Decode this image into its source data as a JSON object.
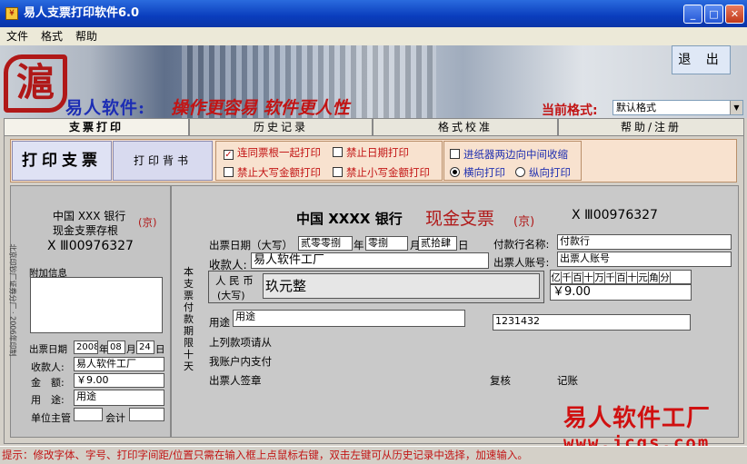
{
  "window": {
    "title": "易人支票打印软件6.0",
    "icon": "app-icon",
    "minimize": "_",
    "maximize": "□",
    "close": "✕"
  },
  "menu": [
    "文件",
    "格式",
    "帮助"
  ],
  "banner": {
    "brand": "易人软件:",
    "slogan": "操作更容易 软件更人性",
    "logo": "滬"
  },
  "exit_label": "退 出",
  "format": {
    "label": "当前格式:",
    "value": "默认格式"
  },
  "tabs": [
    "支票打印",
    "历史记录",
    "格式校准",
    "帮助/注册"
  ],
  "toolbar": {
    "print": "打印支票",
    "print_back": "打印背书"
  },
  "options": {
    "with_stub": {
      "label": "连同票根一起打印",
      "checked": true
    },
    "no_date": {
      "label": "禁止日期打印",
      "checked": false
    },
    "no_upper": {
      "label": "禁止大写金额打印",
      "checked": false
    },
    "no_lower": {
      "label": "禁止小写金额打印",
      "checked": false
    },
    "feed_center": {
      "label": "进纸器两边向中间收缩",
      "checked": false
    },
    "landscape": {
      "label": "横向打印",
      "checked": true
    },
    "portrait": {
      "label": "纵向打印",
      "checked": false
    }
  },
  "stub": {
    "bank": "中国 XXX 银行",
    "title": "现金支票存根",
    "region": "(京)",
    "serial": "X Ⅲ00976327",
    "side_text": "北京印钞厂证券分厂 · 2006年印制",
    "extra_label": "附加信息",
    "date_label": "出票日期",
    "year": "2008",
    "month": "08",
    "day": "24",
    "y": "年",
    "m": "月",
    "d": "日",
    "payee_label": "收款人:",
    "payee": "易人软件工厂",
    "amount_label": "金　额:",
    "amount": "￥9.00",
    "usage_label": "用　途:",
    "usage": "用途",
    "manager_label": "单位主管",
    "accountant_label": "会计"
  },
  "check": {
    "bank": "中国 XXXX 银行",
    "title": "现金支票",
    "region": "(京)",
    "serial": "X Ⅲ00976327",
    "side_text": "本支票付款期限十天",
    "date_label": "出票日期（大写）",
    "year": "贰零零捌",
    "year_unit": "年",
    "month": "零捌",
    "month_unit": "月",
    "day": "贰拾肆",
    "day_unit": "日",
    "bank_name_label": "付款行名称:",
    "bank_name": "付款行",
    "account_label": "出票人账号:",
    "account": "出票人账号",
    "payee_label": "收款人:",
    "payee": "易人软件工厂",
    "rmb_label": "人 民 币",
    "rmb_sub": "(大写)",
    "amount_upper": "玖元整",
    "digits": [
      "亿",
      "千",
      "百",
      "十",
      "万",
      "千",
      "百",
      "十",
      "元",
      "角",
      "分"
    ],
    "amount_lower": "￥9.00",
    "usage_label": "用途",
    "usage": "用途",
    "password": "1231432",
    "line1": "上列款项请从",
    "line2": "我账户内支付",
    "signer_label": "出票人签章",
    "review_label": "复核",
    "record_label": "记账"
  },
  "watermark": {
    "name": "易人软件工厂",
    "url": "www.jcqs.com"
  },
  "status": "提示：修改字体、字号、打印字间距/位置只需在输入框上点鼠标右键，双击左键可从历史记录中选择，加速输入。"
}
